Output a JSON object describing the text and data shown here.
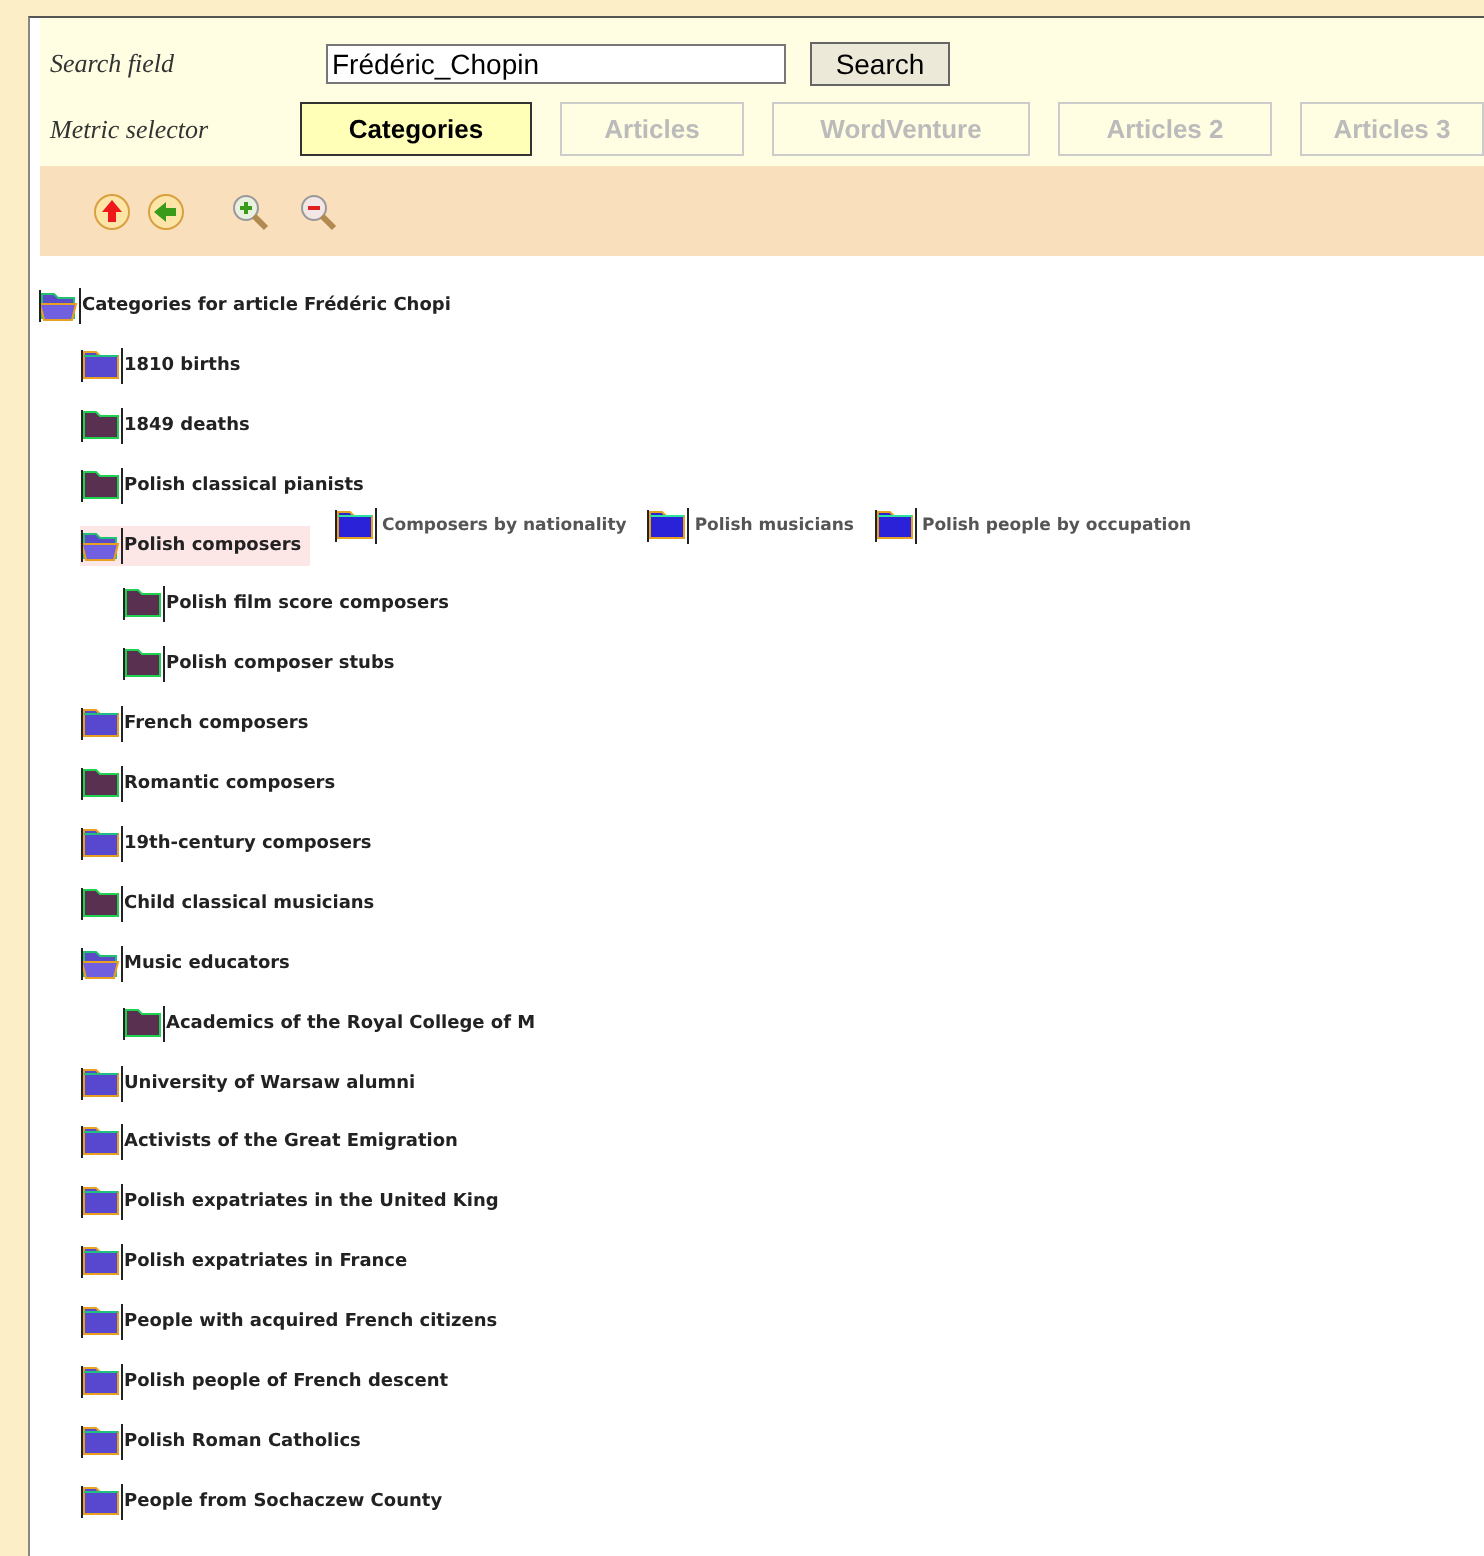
{
  "search": {
    "label": "Search field",
    "value": "Frédéric_Chopin",
    "button": "Search"
  },
  "metric": {
    "label": "Metric selector",
    "tabs": [
      {
        "label": "Categories",
        "selected": true
      },
      {
        "label": "Articles",
        "selected": false
      },
      {
        "label": "WordVenture",
        "selected": false
      },
      {
        "label": "Articles 2",
        "selected": false
      },
      {
        "label": "Articles 3",
        "selected": false
      }
    ]
  },
  "tree": {
    "label": "Categories for article Frédéric Chopi",
    "kind": "branch",
    "expanded": true,
    "selected": false,
    "children": [
      {
        "label": "1810 births",
        "kind": "branch",
        "expanded": false,
        "selected": false
      },
      {
        "label": "1849 deaths",
        "kind": "leaf",
        "expanded": false,
        "selected": false
      },
      {
        "label": "Polish classical pianists",
        "kind": "leaf",
        "expanded": false,
        "selected": false
      },
      {
        "label": "Polish composers",
        "kind": "branch",
        "expanded": true,
        "selected": true,
        "related": [
          {
            "label": "Composers by nationality"
          },
          {
            "label": "Polish musicians"
          },
          {
            "label": "Polish people by occupation"
          }
        ],
        "children": [
          {
            "label": "Polish film score composers",
            "kind": "leaf",
            "expanded": false,
            "selected": false
          },
          {
            "label": "Polish composer stubs",
            "kind": "leaf",
            "expanded": false,
            "selected": false
          }
        ]
      },
      {
        "label": "French composers",
        "kind": "branch",
        "expanded": false,
        "selected": false
      },
      {
        "label": "Romantic composers",
        "kind": "leaf",
        "expanded": false,
        "selected": false
      },
      {
        "label": "19th-century composers",
        "kind": "branch",
        "expanded": false,
        "selected": false
      },
      {
        "label": "Child classical musicians",
        "kind": "leaf",
        "expanded": false,
        "selected": false
      },
      {
        "label": "Music educators",
        "kind": "branch",
        "expanded": true,
        "selected": false,
        "children": [
          {
            "label": "Academics of the Royal College of M",
            "kind": "leaf",
            "expanded": false,
            "selected": false
          }
        ]
      },
      {
        "label": "University of Warsaw alumni",
        "kind": "branch",
        "expanded": false,
        "selected": false
      },
      {
        "label": "Activists of the Great Emigration",
        "kind": "branch",
        "expanded": false,
        "selected": false
      },
      {
        "label": "Polish expatriates in the United King",
        "kind": "branch",
        "expanded": false,
        "selected": false
      },
      {
        "label": "Polish expatriates in France",
        "kind": "branch",
        "expanded": false,
        "selected": false
      },
      {
        "label": "People with acquired French citizens",
        "kind": "branch",
        "expanded": false,
        "selected": false
      },
      {
        "label": "Polish people of French descent",
        "kind": "branch",
        "expanded": false,
        "selected": false
      },
      {
        "label": "Polish Roman Catholics",
        "kind": "branch",
        "expanded": false,
        "selected": false
      },
      {
        "label": "People from Sochaczew County",
        "kind": "branch",
        "expanded": false,
        "selected": false
      }
    ]
  }
}
